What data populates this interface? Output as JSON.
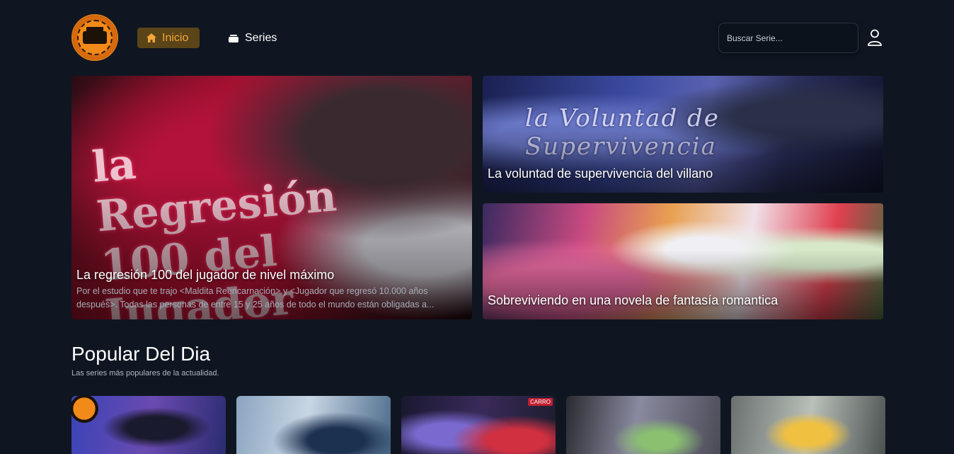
{
  "header": {
    "nav": [
      {
        "label": "Inicio",
        "icon": "home-icon",
        "active": true
      },
      {
        "label": "Series",
        "icon": "stack-icon",
        "active": false
      }
    ],
    "search_placeholder": "Buscar Serie...",
    "accent": "#f5a536"
  },
  "hero": [
    {
      "title": "La regresión 100 del jugador de nivel máximo",
      "description": "Por el estudio que te trajo <Maldita Reencarnación> y <Jugador que regresó 10.000 años después>. Todas las personas de entre 15 y 25 años de todo el mundo están obligadas a...",
      "art_text": "la Regresión 100 del Jugador"
    },
    {
      "title": "La voluntad de supervivencia del villano",
      "art_text": "la Voluntad de Supervivencia"
    },
    {
      "title": "Sobreviviendo en una novela de fantasía romantica"
    }
  ],
  "popular": {
    "title": "Popular Del Dia",
    "subtitle": "Las series más populares de la actualidad.",
    "badge": "CARRO"
  }
}
